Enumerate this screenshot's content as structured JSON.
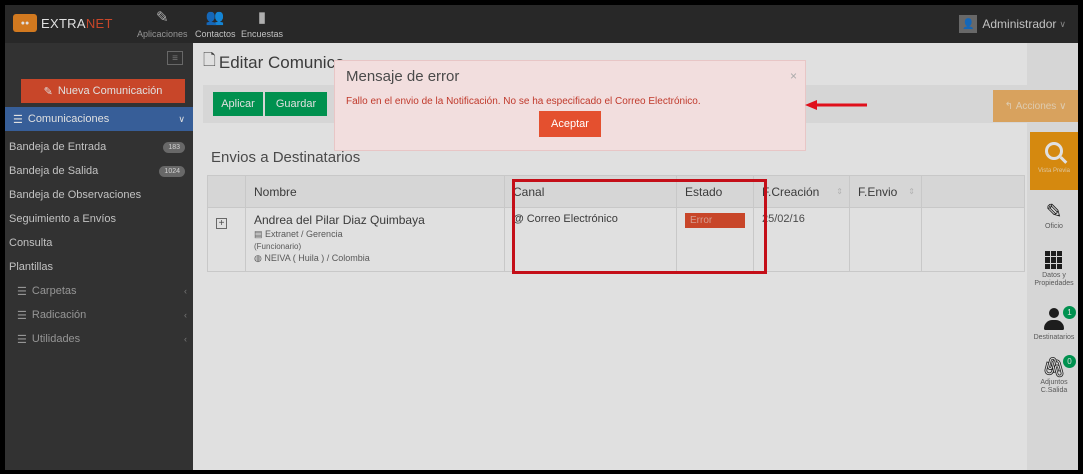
{
  "topbar": {
    "brand_prefix": "EXTRA",
    "brand_suffix": "NET",
    "nav": [
      {
        "label": "Aplicaciones",
        "icon": "pencil-icon"
      },
      {
        "label": "Contactos",
        "icon": "users-icon"
      },
      {
        "label": "Encuestas",
        "icon": "file-icon"
      }
    ],
    "user": "Administrador"
  },
  "sidebar": {
    "new_button": "Nueva Comunicación",
    "section": "Comunicaciones",
    "items": [
      {
        "label": "Bandeja de Entrada",
        "badge": "183"
      },
      {
        "label": "Bandeja de Salida",
        "badge": "1024"
      },
      {
        "label": "Bandeja de Observaciones",
        "badge": ""
      },
      {
        "label": "Seguimiento a Envíos",
        "badge": ""
      },
      {
        "label": "Consulta",
        "badge": ""
      },
      {
        "label": "Plantillas",
        "badge": ""
      }
    ],
    "groups": [
      {
        "label": "Carpetas"
      },
      {
        "label": "Radicación"
      },
      {
        "label": "Utilidades"
      }
    ]
  },
  "main": {
    "page_title": "Editar Comunica",
    "toolbar": {
      "apply_label": "Aplicar",
      "save_label": "Guardar"
    },
    "section_title": "Envios a Destinatarios",
    "table": {
      "headers": [
        "Nombre",
        "Canal",
        "Estado",
        "F.Creación",
        "F.Envio"
      ],
      "rows": [
        {
          "expander": "+",
          "name": "Andrea del Pilar Diaz Quimbaya",
          "org": "Extranet / Gerencia",
          "role": "(Funcionario)",
          "location": "NEIVA ( Huila ) / Colombia",
          "canal": "Correo Electrónico",
          "estado": "Error",
          "f_creacion": "25/02/16",
          "f_envio": ""
        }
      ]
    }
  },
  "right_panel": {
    "actions_label": "Acciones",
    "preview_label": "Vista Previa",
    "items": [
      {
        "label": "Oficio",
        "badge": ""
      },
      {
        "label": "Datos y Propiedades",
        "badge": ""
      },
      {
        "label": "Destinatarios",
        "badge": "1"
      },
      {
        "label": "Adjuntos C.Salida",
        "badge": "0"
      }
    ]
  },
  "modal": {
    "title": "Mensaje de error",
    "message": "Fallo en el envio de la Notificación. No se ha especificado el Correo Electrónico.",
    "ok_label": "Aceptar",
    "close": "×"
  },
  "colors": {
    "topbar": "#2e2e2e",
    "sidebar": "#3a3a3a",
    "primary_red": "#e4502f",
    "section_blue": "#3f6cae",
    "success_green": "#00a65a",
    "warning_orange": "#f39c12",
    "modal_bg": "#f2dede",
    "annotation_red": "#e0101c"
  }
}
